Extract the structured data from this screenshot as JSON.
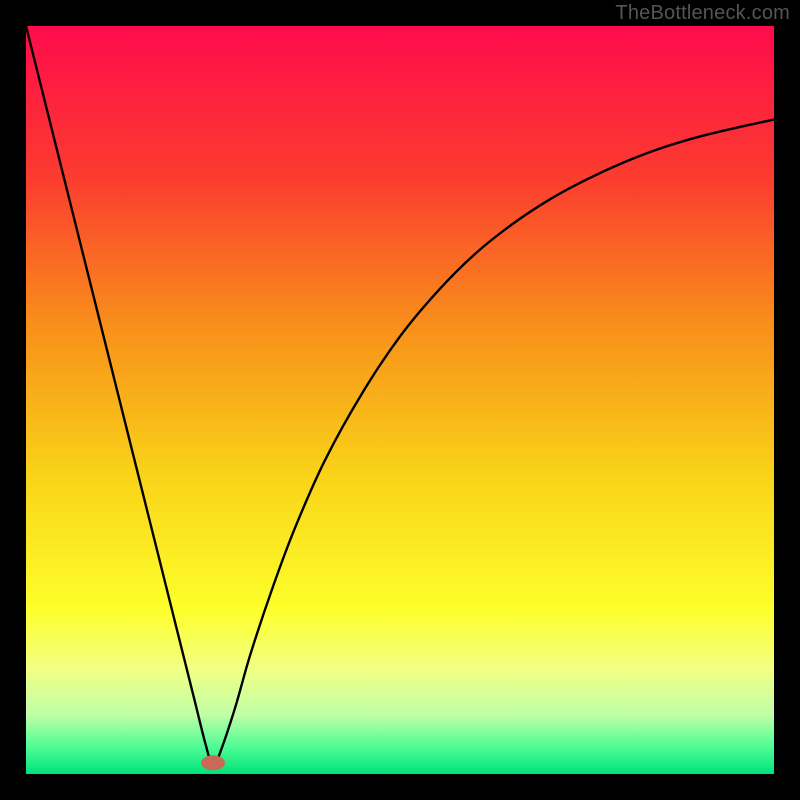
{
  "watermark": {
    "text": "TheBottleneck.com"
  },
  "chart_data": {
    "type": "line",
    "title": "",
    "xlabel": "",
    "ylabel": "",
    "xlim": [
      0,
      100
    ],
    "ylim": [
      0,
      100
    ],
    "grid": false,
    "background_gradient": {
      "stops": [
        {
          "offset": 0.0,
          "color": "#ff0b4c"
        },
        {
          "offset": 0.2,
          "color": "#fb3b2f"
        },
        {
          "offset": 0.4,
          "color": "#f88f1b"
        },
        {
          "offset": 0.6,
          "color": "#f9d318"
        },
        {
          "offset": 0.78,
          "color": "#fdff2b"
        },
        {
          "offset": 0.86,
          "color": "#f2ff84"
        },
        {
          "offset": 0.92,
          "color": "#c0ffa6"
        },
        {
          "offset": 0.965,
          "color": "#4cfc94"
        },
        {
          "offset": 1.0,
          "color": "#00e17a"
        }
      ]
    },
    "marker": {
      "x": 25,
      "y": 1.5,
      "rx": 1.6,
      "ry": 1.0,
      "color": "#c96a59"
    },
    "series": [
      {
        "name": "curve",
        "color": "#000000",
        "points": [
          {
            "x": 0.0,
            "y": 100.0
          },
          {
            "x": 2.5,
            "y": 90.0
          },
          {
            "x": 5.0,
            "y": 80.0
          },
          {
            "x": 7.5,
            "y": 70.0
          },
          {
            "x": 10.0,
            "y": 60.0
          },
          {
            "x": 12.5,
            "y": 50.0
          },
          {
            "x": 15.0,
            "y": 40.0
          },
          {
            "x": 17.5,
            "y": 30.0
          },
          {
            "x": 20.0,
            "y": 20.0
          },
          {
            "x": 22.5,
            "y": 10.0
          },
          {
            "x": 24.0,
            "y": 4.0
          },
          {
            "x": 25.0,
            "y": 1.0
          },
          {
            "x": 26.0,
            "y": 3.0
          },
          {
            "x": 28.0,
            "y": 9.0
          },
          {
            "x": 30.0,
            "y": 16.0
          },
          {
            "x": 33.0,
            "y": 25.0
          },
          {
            "x": 36.0,
            "y": 33.0
          },
          {
            "x": 40.0,
            "y": 42.0
          },
          {
            "x": 45.0,
            "y": 51.0
          },
          {
            "x": 50.0,
            "y": 58.5
          },
          {
            "x": 55.0,
            "y": 64.5
          },
          {
            "x": 60.0,
            "y": 69.5
          },
          {
            "x": 65.0,
            "y": 73.5
          },
          {
            "x": 70.0,
            "y": 76.8
          },
          {
            "x": 75.0,
            "y": 79.5
          },
          {
            "x": 80.0,
            "y": 81.8
          },
          {
            "x": 85.0,
            "y": 83.7
          },
          {
            "x": 90.0,
            "y": 85.2
          },
          {
            "x": 95.0,
            "y": 86.4
          },
          {
            "x": 100.0,
            "y": 87.5
          }
        ]
      }
    ]
  }
}
